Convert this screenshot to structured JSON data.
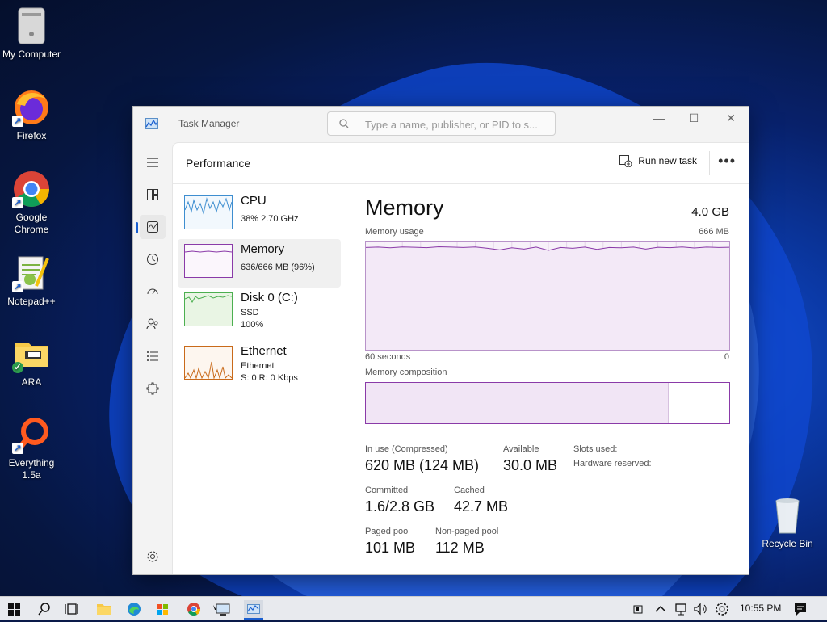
{
  "desktop_icons": [
    {
      "label": "My Computer",
      "icon": "computer-icon"
    },
    {
      "label": "Firefox",
      "icon": "firefox-icon"
    },
    {
      "label": "Google Chrome",
      "icon": "chrome-icon"
    },
    {
      "label": "Notepad++",
      "icon": "notepadpp-icon"
    },
    {
      "label": "ARA",
      "icon": "folder-icon"
    },
    {
      "label": "Everything 1.5a",
      "icon": "everything-icon"
    },
    {
      "label": "Recycle Bin",
      "icon": "recycle-bin-icon"
    }
  ],
  "window": {
    "title": "Task Manager",
    "search_placeholder": "Type a name, publisher, or PID to s...",
    "page_title": "Performance",
    "run_new_task": "Run new task",
    "more": "•••"
  },
  "perf_list": [
    {
      "name": "CPU",
      "sub1": "38%  2.70 GHz",
      "sub2": "",
      "sub3": ""
    },
    {
      "name": "Memory",
      "sub1": "636/666 MB (96%)",
      "sub2": "",
      "sub3": ""
    },
    {
      "name": "Disk 0 (C:)",
      "sub1": "SSD",
      "sub2": "100%",
      "sub3": ""
    },
    {
      "name": "Ethernet",
      "sub1": "Ethernet",
      "sub2": "S: 0  R: 0 Kbps",
      "sub3": ""
    }
  ],
  "memory": {
    "title": "Memory",
    "capacity": "4.0 GB",
    "usage_label": "Memory usage",
    "usage_max": "666 MB",
    "x_left": "60 seconds",
    "x_right": "0",
    "composition_label": "Memory composition",
    "in_use_fraction": 0.83,
    "stats": {
      "in_use_label": "In use (Compressed)",
      "in_use": "620 MB (124 MB)",
      "available_label": "Available",
      "available": "30.0 MB",
      "slots_label": "Slots used:",
      "hw_reserved_label": "Hardware reserved:",
      "committed_label": "Committed",
      "committed": "1.6/2.8 GB",
      "cached_label": "Cached",
      "cached": "42.7 MB",
      "paged_label": "Paged pool",
      "paged": "101 MB",
      "nonpaged_label": "Non-paged pool",
      "nonpaged": "112 MB"
    }
  },
  "chart_data": {
    "type": "line",
    "title": "Memory usage",
    "x": [
      60,
      58,
      56,
      54,
      52,
      50,
      48,
      46,
      44,
      42,
      40,
      38,
      36,
      34,
      32,
      30,
      28,
      26,
      24,
      22,
      20,
      18,
      16,
      14,
      12,
      10,
      8,
      6,
      4,
      2,
      0
    ],
    "x_range": [
      60,
      0
    ],
    "ylim": [
      0,
      666
    ],
    "series": [
      {
        "values": [
          630,
          632,
          628,
          633,
          631,
          629,
          634,
          632,
          630,
          633,
          625,
          615,
          628,
          620,
          632,
          612,
          630,
          625,
          632,
          618,
          630,
          628,
          632,
          620,
          631,
          629,
          633,
          627,
          632,
          630,
          631
        ]
      }
    ]
  },
  "taskbar": {
    "time": "10:55 PM"
  },
  "colors": {
    "memory_accent": "#8a3aa8",
    "accent": "#1a5fd0"
  }
}
